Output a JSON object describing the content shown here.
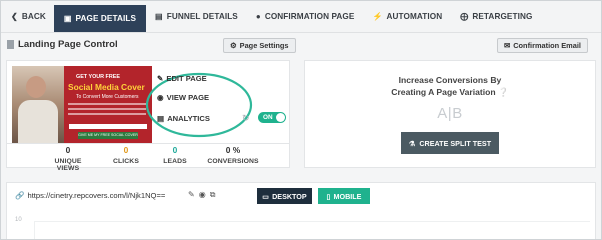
{
  "nav": {
    "back": "BACK",
    "items": [
      {
        "label": "PAGE DETAILS",
        "icon": "gauge-icon"
      },
      {
        "label": "FUNNEL DETAILS",
        "icon": "bar-chart-icon"
      },
      {
        "label": "CONFIRMATION PAGE",
        "icon": "circle-icon"
      },
      {
        "label": "AUTOMATION",
        "icon": "bolt-icon"
      },
      {
        "label": "RETARGETING",
        "icon": "crosshair-icon"
      }
    ]
  },
  "header": {
    "title": "Landing Page Control",
    "settings_button": "Page Settings",
    "email_button": "Confirmation Email"
  },
  "page_card": {
    "thumbnail": {
      "line1": "GET YOUR FREE",
      "line2": "Social Media Cover",
      "line3": "To Convert More Customers",
      "cta": "GIVE ME MY FREE SOCIAL COVER"
    },
    "actions": {
      "edit": "EDIT PAGE",
      "view": "VIEW PAGE",
      "analytics": "ANALYTICS"
    },
    "toggle_label": "ON",
    "stats": [
      {
        "value": "0",
        "label": "UNIQUE VIEWS"
      },
      {
        "value": "0",
        "label": "CLICKS"
      },
      {
        "value": "0",
        "label": "LEADS"
      },
      {
        "value": "0 %",
        "label": "CONVERSIONS"
      }
    ]
  },
  "split_card": {
    "title_line1": "Increase Conversions By",
    "title_line2": "Creating A Page Variation",
    "ab_text": "A|B",
    "button": "CREATE SPLIT TEST"
  },
  "preview": {
    "url": "https://cinetry.repcovers.com/l/Njk1NQ==",
    "desktop_button": "DESKTOP",
    "mobile_button": "MOBILE",
    "axis_value": "10"
  },
  "colors": {
    "nav_active": "#2e4159",
    "accent_green": "#1fb28e",
    "clicks_orange": "#e19a1d",
    "leads_teal": "#1fa99a",
    "split_button": "#4b5a62",
    "desktop_button": "#1e2e3d"
  }
}
